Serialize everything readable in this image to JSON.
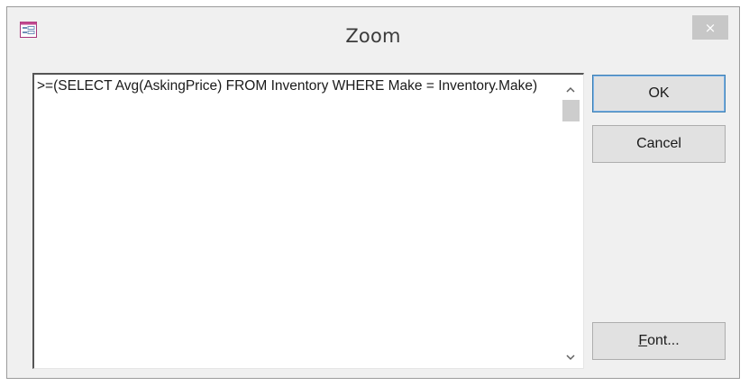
{
  "window": {
    "title": "Zoom",
    "close_glyph": "×",
    "app_icon": "form-icon"
  },
  "editor": {
    "text": ">=(SELECT Avg(AskingPrice) FROM Inventory WHERE Make = Inventory.Make)",
    "scroll_up_icon": "chevron-up-icon",
    "scroll_down_icon": "chevron-down-icon"
  },
  "buttons": {
    "ok_label": "OK",
    "cancel_label": "Cancel",
    "font_label": "Font..."
  },
  "colors": {
    "dialog_bg": "#f0f0f0",
    "close_bg": "#c7c7c7",
    "default_button_border": "#3c7fb1",
    "button_bg": "#e1e1e1"
  }
}
